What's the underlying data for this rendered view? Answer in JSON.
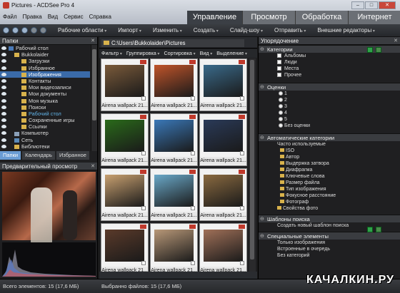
{
  "window": {
    "title": "Pictures - ACDSee Pro 4"
  },
  "menu": [
    "Файл",
    "Правка",
    "Вид",
    "Сервис",
    "Справка"
  ],
  "modes": [
    "Управление",
    "Просмотр",
    "Обработка",
    "Интернет"
  ],
  "toolbar": [
    "Рабочие области",
    "Импорт",
    "Изменить",
    "Создать",
    "Слайд-шоу",
    "Отправить",
    "Внешние редакторы"
  ],
  "left": {
    "header": "Папки",
    "tree": [
      "Рабочий стол",
      "Bukkolaider",
      "Загрузки",
      "Избранное",
      "Изображения",
      "Контакты",
      "Мои видеозаписи",
      "Мои документы",
      "Моя музыка",
      "Поиски",
      "Рабочий стол",
      "Сохраненные игры",
      "Ссылки",
      "Компьютер",
      "Сеть",
      "Библиотеки"
    ],
    "tabs": [
      "Папки",
      "Календарь",
      "Избранное"
    ],
    "preview_header": "Предварительный просмотр"
  },
  "center": {
    "path": "C:\\Users\\Bukkolaider\\Pictures",
    "filters": [
      "Фильтр",
      "Группировка",
      "Сортировка",
      "Вид",
      "Выделение"
    ],
    "thumbs": [
      {
        "caption": "Airena wallpack 21...",
        "color": "#7a5a3a"
      },
      {
        "caption": "Airena wallpack 21...",
        "color": "#c0542a"
      },
      {
        "caption": "Airena wallpack 21...",
        "color": "#3a6a8a"
      },
      {
        "caption": "Airena wallpack 21...",
        "color": "#2a6a1a"
      },
      {
        "caption": "Airena wallpack 21...",
        "color": "#3a78b8"
      },
      {
        "caption": "Airena wallpack 21...",
        "color": "#2a3a58"
      },
      {
        "caption": "Airena wallpack 21...",
        "color": "#c8a070"
      },
      {
        "caption": "Airena wallpack 21...",
        "color": "#6aa8c8"
      },
      {
        "caption": "Airena wallpack 21...",
        "color": "#8a6a40"
      },
      {
        "caption": "Airena wallpack 21...",
        "color": "#5a3a2a"
      },
      {
        "caption": "Airena wallpack 21...",
        "color": "#b89878"
      },
      {
        "caption": "Airena wallpack 21...",
        "color": "#a07058"
      }
    ]
  },
  "right": {
    "header": "Упорядочение",
    "categories_title": "Категории",
    "categories": [
      "Альбомы",
      "Люди",
      "Места",
      "Прочее"
    ],
    "ratings_title": "Оценки",
    "ratings": [
      "1",
      "2",
      "3",
      "4",
      "5",
      "Без оценки"
    ],
    "auto_title": "Автоматические категории",
    "auto_sub": "Часто используемые",
    "auto": [
      "ISO",
      "Автор",
      "Выдержка затвора",
      "Диафрагма",
      "Ключевые слова",
      "Размер файла",
      "Тип изображения",
      "Фокусное расстояние",
      "Фотограф"
    ],
    "props": "Свойства фото",
    "search_title": "Шаблоны поиска",
    "search_item": "Создать новый шаблон поиска",
    "special_title": "Специальные элементы",
    "special": [
      "Только изображения",
      "Встроенные в очередь",
      "Без категорий"
    ]
  },
  "status": {
    "total": "Всего элементов: 15  (17,6 МБ)",
    "selected": "Выбранно файлов: 15  (17,6 МБ)"
  },
  "watermark": "КАЧАЛКИН.РУ"
}
